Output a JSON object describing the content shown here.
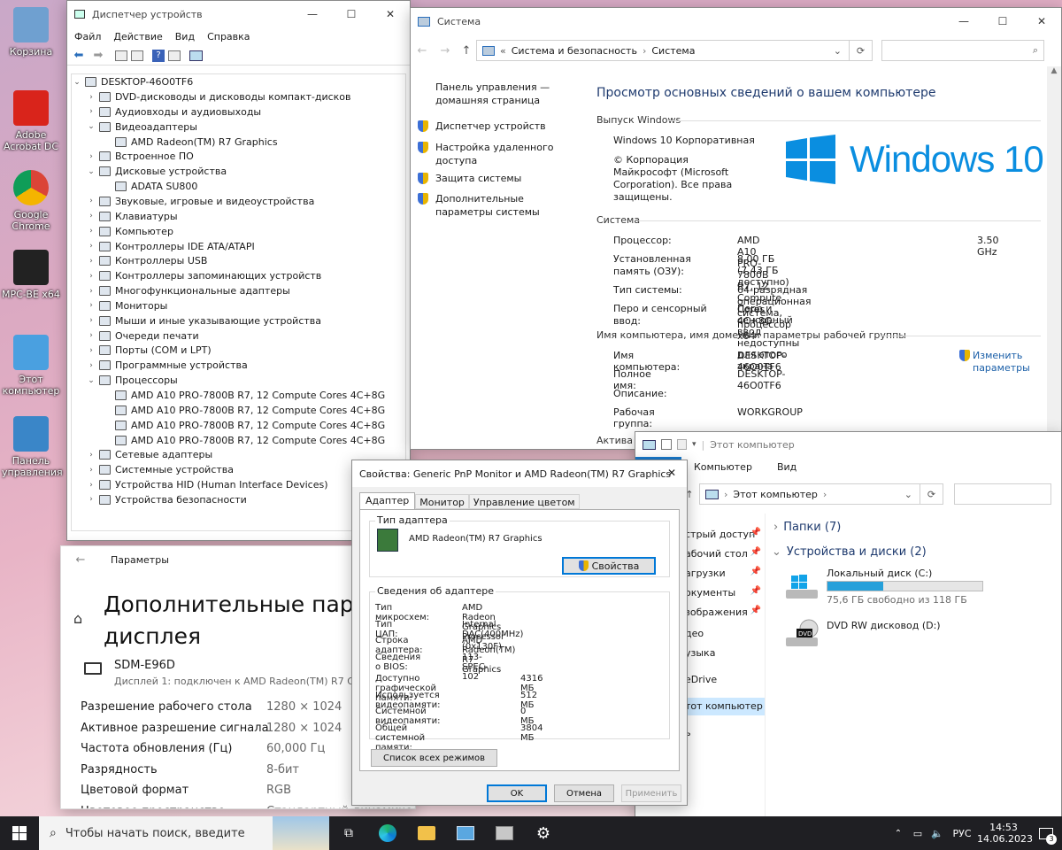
{
  "desktop": {
    "icons": [
      {
        "label": "Корзина",
        "name": "recycle-bin-icon"
      },
      {
        "label": "Adobe Acrobat DC",
        "name": "acrobat-icon"
      },
      {
        "label": "Google Chrome",
        "name": "chrome-icon"
      },
      {
        "label": "MPC-BE x64",
        "name": "mpc-be-icon"
      },
      {
        "label": "Этот компьютер",
        "name": "this-pc-icon"
      },
      {
        "label": "Панель управления",
        "name": "control-panel-icon"
      }
    ]
  },
  "devmgr": {
    "title": "Диспетчер устройств",
    "menu": [
      "Файл",
      "Действие",
      "Вид",
      "Справка"
    ],
    "root": "DESKTOP-46O0TF6",
    "items": [
      {
        "label": "DVD-дисководы и дисководы компакт-дисков",
        "level": 1,
        "expanded": false
      },
      {
        "label": "Аудиовходы и аудиовыходы",
        "level": 1,
        "expanded": false
      },
      {
        "label": "Видеоадаптеры",
        "level": 1,
        "expanded": true
      },
      {
        "label": "AMD Radeon(TM) R7 Graphics",
        "level": 2
      },
      {
        "label": "Встроенное ПО",
        "level": 1,
        "expanded": false
      },
      {
        "label": "Дисковые устройства",
        "level": 1,
        "expanded": true
      },
      {
        "label": "ADATA SU800",
        "level": 2
      },
      {
        "label": "Звуковые, игровые и видеоустройства",
        "level": 1,
        "expanded": false
      },
      {
        "label": "Клавиатуры",
        "level": 1,
        "expanded": false
      },
      {
        "label": "Компьютер",
        "level": 1,
        "expanded": false
      },
      {
        "label": "Контроллеры IDE ATA/ATAPI",
        "level": 1,
        "expanded": false
      },
      {
        "label": "Контроллеры USB",
        "level": 1,
        "expanded": false
      },
      {
        "label": "Контроллеры запоминающих устройств",
        "level": 1,
        "expanded": false
      },
      {
        "label": "Многофункциональные адаптеры",
        "level": 1,
        "expanded": false
      },
      {
        "label": "Мониторы",
        "level": 1,
        "expanded": false
      },
      {
        "label": "Мыши и иные указывающие устройства",
        "level": 1,
        "expanded": false
      },
      {
        "label": "Очереди печати",
        "level": 1,
        "expanded": false
      },
      {
        "label": "Порты (COM и LPT)",
        "level": 1,
        "expanded": false
      },
      {
        "label": "Программные устройства",
        "level": 1,
        "expanded": false
      },
      {
        "label": "Процессоры",
        "level": 1,
        "expanded": true
      },
      {
        "label": "AMD A10 PRO-7800B R7, 12 Compute Cores 4C+8G",
        "level": 2
      },
      {
        "label": "AMD A10 PRO-7800B R7, 12 Compute Cores 4C+8G",
        "level": 2
      },
      {
        "label": "AMD A10 PRO-7800B R7, 12 Compute Cores 4C+8G",
        "level": 2
      },
      {
        "label": "AMD A10 PRO-7800B R7, 12 Compute Cores 4C+8G",
        "level": 2
      },
      {
        "label": "Сетевые адаптеры",
        "level": 1,
        "expanded": false
      },
      {
        "label": "Системные устройства",
        "level": 1,
        "expanded": false
      },
      {
        "label": "Устройства HID (Human Interface Devices)",
        "level": 1,
        "expanded": false
      },
      {
        "label": "Устройства безопасности",
        "level": 1,
        "expanded": false
      }
    ]
  },
  "system": {
    "title": "Система",
    "breadcrumb_prefix": "«",
    "breadcrumb": [
      "Система и безопасность",
      "Система"
    ],
    "side": {
      "home": "Панель управления — домашняя страница",
      "links": [
        "Диспетчер устройств",
        "Настройка удаленного доступа",
        "Защита системы",
        "Дополнительные параметры системы"
      ]
    },
    "heading": "Просмотр основных сведений о вашем компьютере",
    "edition_header": "Выпуск Windows",
    "edition": "Windows 10 Корпоративная",
    "copyright": "© Корпорация Майкрософт (Microsoft Corporation). Все права защищены.",
    "logo_text": "Windows 10",
    "system_header": "Система",
    "rows": [
      {
        "k": "Процессор:",
        "v": "AMD A10 PRO-7800B R7, 12 Compute Cores 4C+8G",
        "extra": "3.50 GHz"
      },
      {
        "k": "Установленная память (ОЗУ):",
        "v": "8,00 ГБ (7,43 ГБ доступно)"
      },
      {
        "k": "Тип системы:",
        "v": "64-разрядная операционная система, процессор x64"
      },
      {
        "k": "Перо и сенсорный ввод:",
        "v": "Перо и сенсорный ввод недоступны для этого экрана"
      }
    ],
    "name_header": "Имя компьютера, имя домена и параметры рабочей группы",
    "name_rows": [
      {
        "k": "Имя компьютера:",
        "v": "DESKTOP-46O0TF6"
      },
      {
        "k": "Полное имя:",
        "v": "DESKTOP-46O0TF6"
      },
      {
        "k": "Описание:",
        "v": ""
      },
      {
        "k": "Рабочая группа:",
        "v": "WORKGROUP"
      }
    ],
    "change": "Изменить параметры",
    "activation": "Актива"
  },
  "explorer": {
    "title": "Этот компьютер",
    "tabs": [
      "Компьютер",
      "Вид"
    ],
    "address": "Этот компьютер",
    "folders": "Папки (7)",
    "drives_header": "Устройства и диски (2)",
    "drives": [
      {
        "name": "Локальный диск (C:)",
        "free": "75,6 ГБ свободно из 118 ГБ",
        "used": 0.36
      },
      {
        "name": "DVD RW дисковод (D:)"
      }
    ],
    "nav": [
      "стрый доступ",
      "абочий стол",
      "агрузки",
      "окументы",
      "зображения",
      "део",
      "узыка",
      "eDrive",
      "тот компьютер",
      "ь"
    ]
  },
  "props": {
    "title": "Свойства: Generic PnP Monitor и AMD Radeon(TM) R7 Graphics",
    "tabs": [
      "Адаптер",
      "Монитор",
      "Управление цветом"
    ],
    "type_group": "Тип адаптера",
    "adapter": "AMD Radeon(TM) R7 Graphics",
    "props_btn": "Свойства",
    "info_group": "Сведения об адаптере",
    "info": [
      {
        "k": "Тип микросхем:",
        "v": "AMD Radeon Graphics Processor (0x130F)"
      },
      {
        "k": "Тип ЦАП:",
        "v": "Internal DAC(400MHz)"
      },
      {
        "k": "Строка адаптера:",
        "v": "AMD Radeon(TM) R7 Graphics"
      },
      {
        "k": "Сведения о BIOS:",
        "v": "113-SPEC-102"
      }
    ],
    "mem": [
      {
        "k": "Доступно графической памяти:",
        "v": "4316 МБ"
      },
      {
        "k": "Используется видеопамяти:",
        "v": "512 МБ"
      },
      {
        "k": "Системной видеопамяти:",
        "v": "0 МБ"
      },
      {
        "k": "Общей системной памяти:",
        "v": "3804 МБ"
      }
    ],
    "modes_btn": "Список всех режимов",
    "ok": "OK",
    "cancel": "Отмена",
    "apply": "Применить"
  },
  "settings": {
    "title": "Параметры",
    "heading1": "Дополнительные парам",
    "heading2": "дисплея",
    "monitor": "SDM-E96D",
    "monitor_sub": "Дисплей 1: подключен к AMD Radeon(TM) R7 Gra",
    "rows": [
      {
        "k": "Разрешение рабочего стола",
        "v": "1280 × 1024"
      },
      {
        "k": "Активное разрешение сигнала",
        "v": "1280 × 1024"
      },
      {
        "k": "Частота обновления (Гц)",
        "v": "60,000 Гц"
      },
      {
        "k": "Разрядность",
        "v": "8-бит"
      },
      {
        "k": "Цветовой формат",
        "v": "RGB"
      },
      {
        "k": "Цветовое пространство",
        "v": "Стандартный динамический"
      }
    ]
  },
  "taskbar": {
    "search": "Чтобы начать поиск, введите",
    "lang": "РУС",
    "time": "14:53",
    "date": "14.06.2023",
    "notif": "3"
  }
}
